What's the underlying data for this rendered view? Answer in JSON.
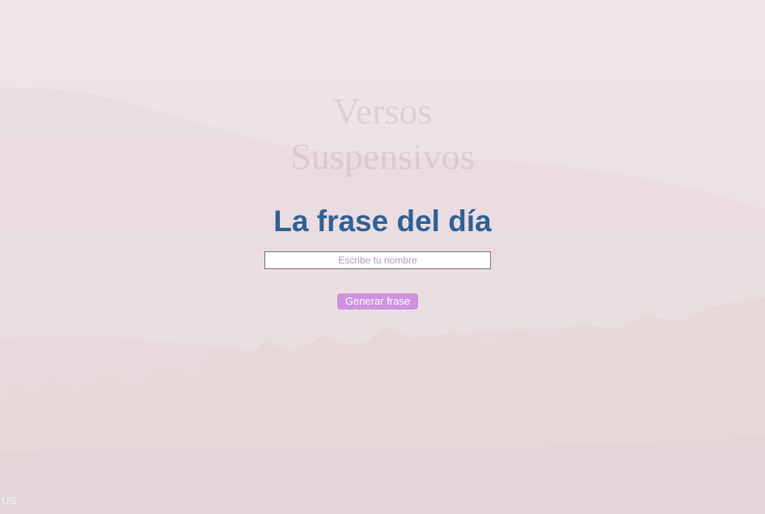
{
  "logo": {
    "line1": "Versos",
    "line2": "Suspensivos"
  },
  "main": {
    "title": "La frase del día",
    "name_input": {
      "value": "",
      "placeholder": "Escribe tu nombre"
    },
    "generate_button_label": "Generar frase"
  },
  "corner_text": "US",
  "colors": {
    "background": "#efe3e5",
    "title": "#2f6196",
    "button": "#cf92e0",
    "button_text": "#ffffff",
    "placeholder": "#b59bb6"
  }
}
